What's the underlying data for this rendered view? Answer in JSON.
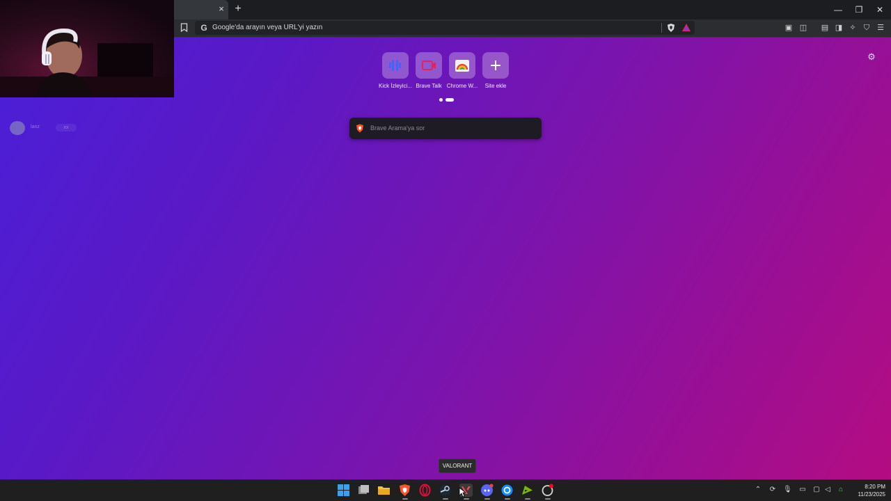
{
  "browser": {
    "tab": {
      "close_glyph": "×"
    },
    "new_tab_glyph": "+",
    "window_controls": {
      "minimize": "—",
      "maximize": "❐",
      "close": "✕"
    },
    "omnibox": {
      "search_engine_icon": "G",
      "placeholder": "Google'da arayın veya URL'yi yazın"
    }
  },
  "new_tab_page": {
    "tiles": [
      {
        "label": "Kick İzleyici...",
        "icon": "kick-viewer-icon"
      },
      {
        "label": "Brave Talk",
        "icon": "brave-talk-icon"
      },
      {
        "label": "Chrome W...",
        "icon": "chrome-web-store-icon"
      },
      {
        "label": "Site ekle",
        "icon": "plus-icon"
      }
    ],
    "search_placeholder": "Brave Arama'ya sor"
  },
  "overlay": {
    "chat_name": "lanz",
    "chat_badge": "xx"
  },
  "tooltip": "VALORANT",
  "taskbar": {
    "apps": [
      "windows-start",
      "task-view",
      "file-explorer",
      "brave",
      "opera-gx",
      "steam",
      "valorant",
      "discord",
      "battlenet",
      "nvidia",
      "overwolf"
    ],
    "clock": {
      "time": "8:20 PM",
      "date": "11/23/2025"
    }
  },
  "colors": {
    "ntp_gradient_start": "#4a1fd8",
    "ntp_gradient_end": "#b40c82",
    "taskbar": "#1f1f1f"
  }
}
